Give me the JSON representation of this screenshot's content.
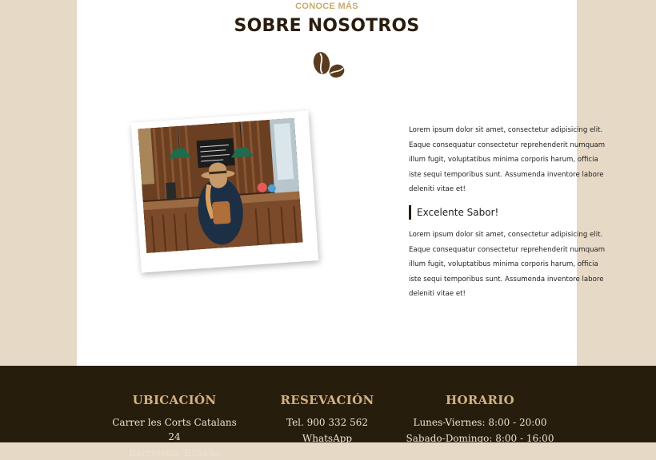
{
  "about": {
    "eyebrow": "CONOCE MÁS",
    "title": "SOBRE NOSOTROS",
    "icon": "coffee-beans-icon",
    "paragraph_1": "Lorem ipsum dolor sit amet, consectetur adipisicing elit. Eaque consequatur consectetur reprehenderit numquam illum fugit, voluptatibus minima corporis harum, officia iste sequi temporibus sunt. Assumenda inventore labore deleniti vitae et!",
    "quote": "Excelente Sabor!",
    "paragraph_2": "Lorem ipsum dolor sit amet, consectetur adipisicing elit. Eaque consequatur consectetur reprehenderit numquam illum fugit, voluptatibus minima corporis harum, officia iste sequi temporibus sunt. Assumenda inventore labore deleniti vitae et!"
  },
  "footer": {
    "location": {
      "heading": "UBICACIÓN",
      "line_1": "Carrer les Corts Catalans 24",
      "line_2": "Barcelona, España"
    },
    "reservation": {
      "heading": "RESEVACIÓN",
      "line_1": "Tel. 900 332 562",
      "line_2": "WhatsApp"
    },
    "schedule": {
      "heading": "HORARIO",
      "line_1": "Lunes-Viernes: 8:00 - 20:00",
      "line_2": "Sabado-Domingo: 8:00 - 16:00"
    }
  },
  "colors": {
    "page_bg": "#e6dac6",
    "accent_gold": "#c9a96b",
    "dark_brown": "#2a1d0e",
    "footer_bg": "#271d0c"
  }
}
